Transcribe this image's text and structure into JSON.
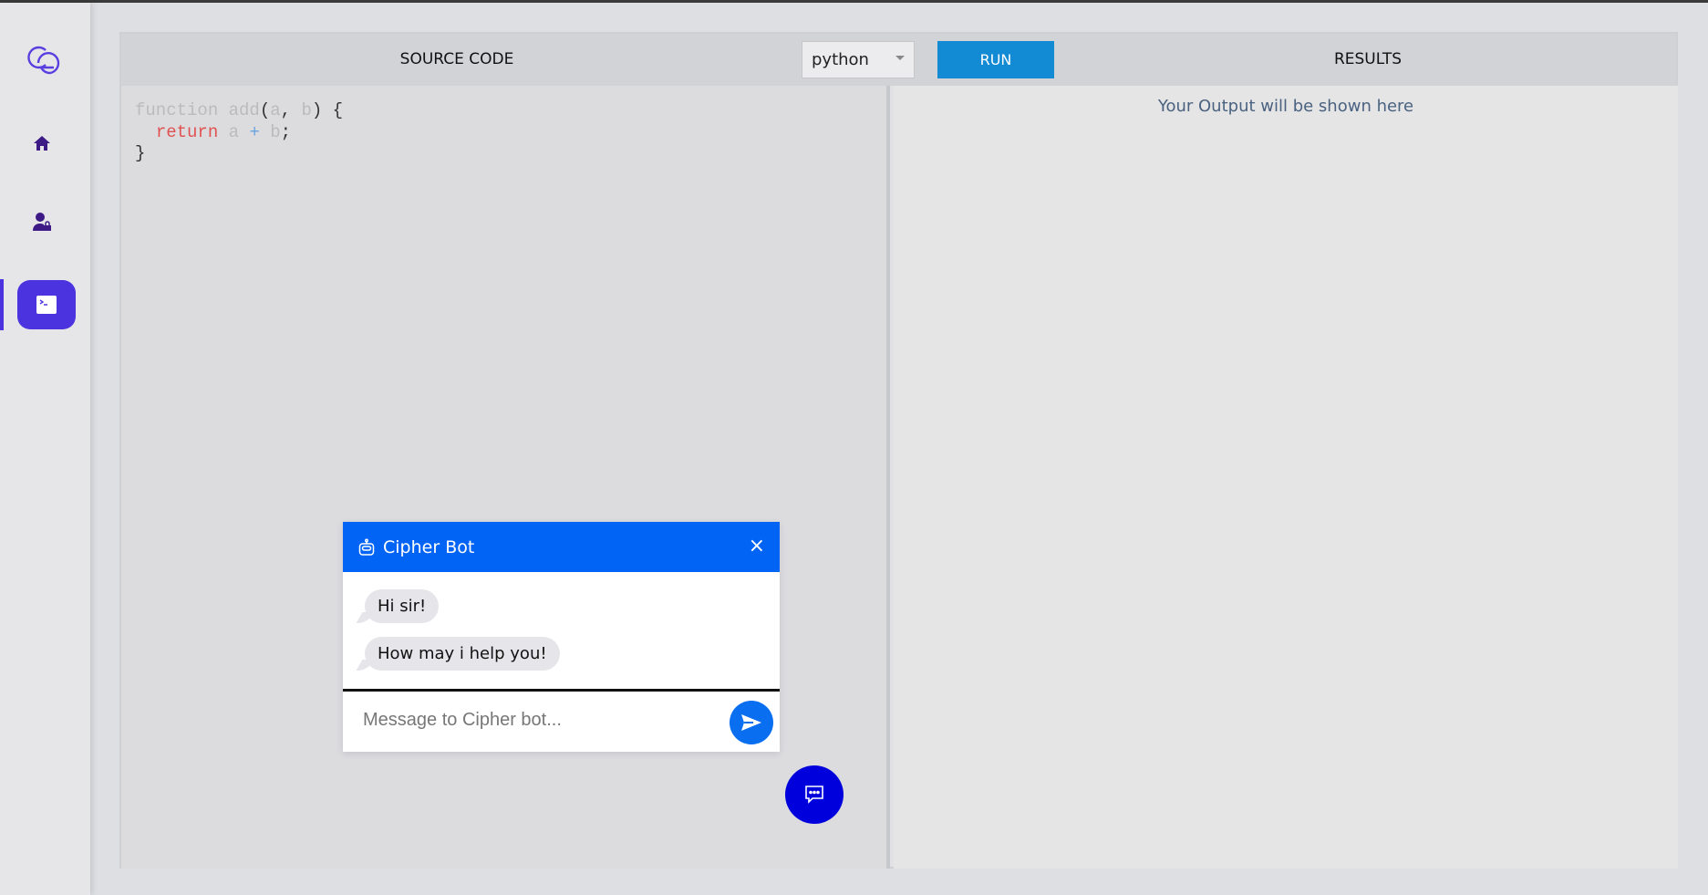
{
  "sidebar": {
    "items": [
      {
        "icon": "logo-icon"
      },
      {
        "icon": "home-icon"
      },
      {
        "icon": "user-lock-icon"
      },
      {
        "icon": "terminal-icon",
        "active": true
      }
    ],
    "accent": "#4b34e0"
  },
  "toolbar": {
    "source_title": "SOURCE CODE",
    "language": "python",
    "run_label": "RUN",
    "results_title": "RESULTS"
  },
  "editor": {
    "lines": [
      [
        {
          "t": "function add",
          "c": "kw"
        },
        {
          "t": "(",
          "c": ""
        },
        {
          "t": "a",
          "c": "kw"
        },
        {
          "t": ", ",
          "c": ""
        },
        {
          "t": "b",
          "c": "kw"
        },
        {
          "t": ") {",
          "c": ""
        }
      ],
      [
        {
          "t": "  ",
          "c": ""
        },
        {
          "t": "return",
          "c": "ret"
        },
        {
          "t": " a ",
          "c": "kw"
        },
        {
          "t": "+",
          "c": "op"
        },
        {
          "t": " b",
          "c": "kw"
        },
        {
          "t": ";",
          "c": ""
        }
      ],
      [
        {
          "t": "}",
          "c": ""
        }
      ]
    ]
  },
  "results": {
    "placeholder": "Your Output will be shown here"
  },
  "chat": {
    "title": "Cipher Bot",
    "close": "×",
    "messages": [
      "Hi sir!",
      "How may i help you!"
    ],
    "input_placeholder": "Message to Cipher bot...",
    "header_color": "#0164f4"
  }
}
